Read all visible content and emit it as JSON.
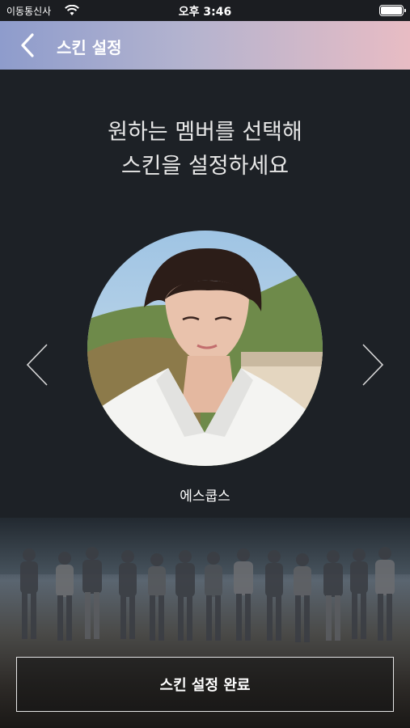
{
  "status_bar": {
    "carrier": "이동통신사",
    "time": "오후 3:46"
  },
  "header": {
    "title": "스킨 설정"
  },
  "instruction": {
    "line1": "원하는 멤버를 선택해",
    "line2": "스킨을 설정하세요"
  },
  "member": {
    "name": "에스쿱스"
  },
  "complete_button": {
    "label": "스킨 설정 완료"
  }
}
